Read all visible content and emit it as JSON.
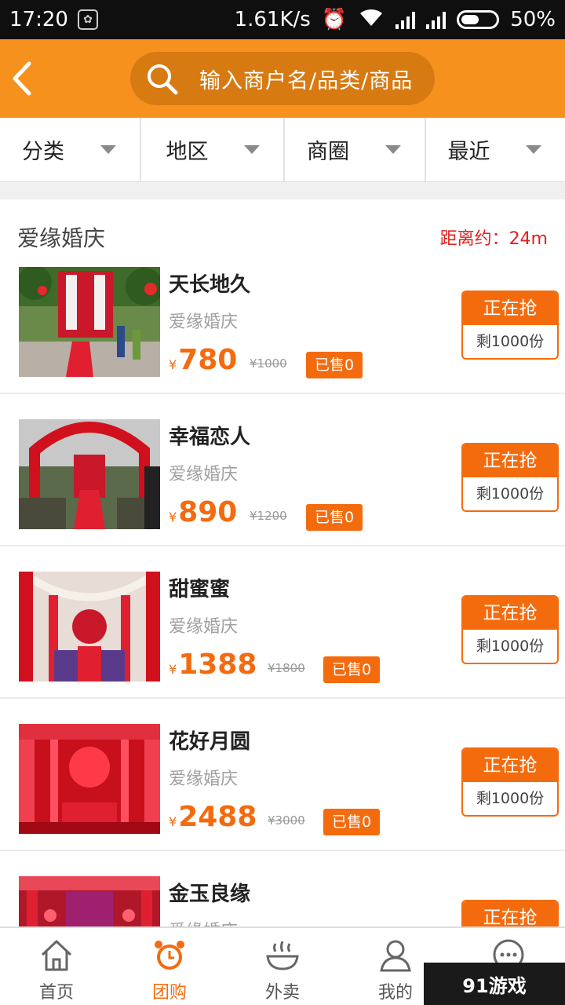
{
  "status_bar": {
    "time": "17:20",
    "network_speed": "1.61K/s",
    "battery": "50%"
  },
  "header": {
    "back_icon": "chevron-left-icon",
    "search_placeholder": "输入商户名/品类/商品"
  },
  "filters": [
    {
      "label": "分类"
    },
    {
      "label": "地区"
    },
    {
      "label": "商圈"
    },
    {
      "label": "最近"
    }
  ],
  "merchant": {
    "name": "爱缘婚庆",
    "distance": "距离约：24m"
  },
  "deals": [
    {
      "title": "天长地久",
      "shop": "爱缘婚庆",
      "currency": "¥",
      "price": "780",
      "original_price": "¥1000",
      "sold": "已售0",
      "button": "正在抢",
      "remaining": "剩1000份"
    },
    {
      "title": "幸福恋人",
      "shop": "爱缘婚庆",
      "currency": "¥",
      "price": "890",
      "original_price": "¥1200",
      "sold": "已售0",
      "button": "正在抢",
      "remaining": "剩1000份"
    },
    {
      "title": "甜蜜蜜",
      "shop": "爱缘婚庆",
      "currency": "¥",
      "price": "1388",
      "original_price": "¥1800",
      "sold": "已售0",
      "button": "正在抢",
      "remaining": "剩1000份"
    },
    {
      "title": "花好月圆",
      "shop": "爱缘婚庆",
      "currency": "¥",
      "price": "2488",
      "original_price": "¥3000",
      "sold": "已售0",
      "button": "正在抢",
      "remaining": "剩1000份"
    },
    {
      "title": "金玉良缘",
      "shop": "爱缘婚庆",
      "currency": "¥",
      "price": "",
      "original_price": "",
      "sold": "",
      "button": "正在抢",
      "remaining": ""
    }
  ],
  "tabs": [
    {
      "label": "首页",
      "icon": "home-icon",
      "active": false
    },
    {
      "label": "团购",
      "icon": "alarm-clock-icon",
      "active": true
    },
    {
      "label": "外卖",
      "icon": "bowl-icon",
      "active": false
    },
    {
      "label": "我的",
      "icon": "person-icon",
      "active": false
    },
    {
      "label": "",
      "icon": "chat-bubble-icon",
      "active": false
    }
  ],
  "watermark": "91游戏",
  "colors": {
    "brand_orange": "#f7911d",
    "accent_orange": "#f46b0e",
    "distance_red": "#e02020"
  }
}
